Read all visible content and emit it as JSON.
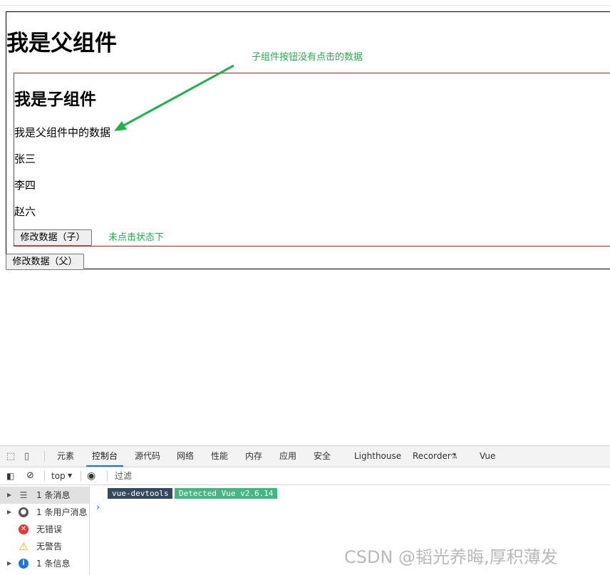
{
  "page": {
    "parent_title": "我是父组件",
    "child_title": "我是子组件",
    "child_message": "我是父组件中的数据",
    "names": [
      "张三",
      "李四",
      "赵六"
    ],
    "child_button": "修改数据（子）",
    "parent_button": "修改数据（父）"
  },
  "annotations": {
    "arrow_note": "子组件按钮没有点击的数据",
    "state_note": "未点击状态下",
    "color": "#22b14c"
  },
  "devtools": {
    "tabs": [
      "元素",
      "控制台",
      "源代码",
      "网络",
      "性能",
      "内存",
      "应用",
      "安全",
      "Lighthouse",
      "Recorder",
      "Vue"
    ],
    "active_tab": "控制台",
    "context": "top",
    "filter_placeholder": "过滤",
    "sidebar": [
      {
        "label": "1 条消息",
        "icon": "list-icon"
      },
      {
        "label": "1 条用户消息",
        "icon": "user-icon"
      },
      {
        "label": "无错误",
        "icon": "error-icon"
      },
      {
        "label": "无警告",
        "icon": "warning-icon"
      },
      {
        "label": "1 条信息",
        "icon": "info-icon"
      }
    ],
    "badge_left": "vue-devtools",
    "badge_right": "Detected Vue v2.6.14",
    "prompt": "›"
  },
  "watermark": "CSDN @韬光养晦,厚积薄发"
}
